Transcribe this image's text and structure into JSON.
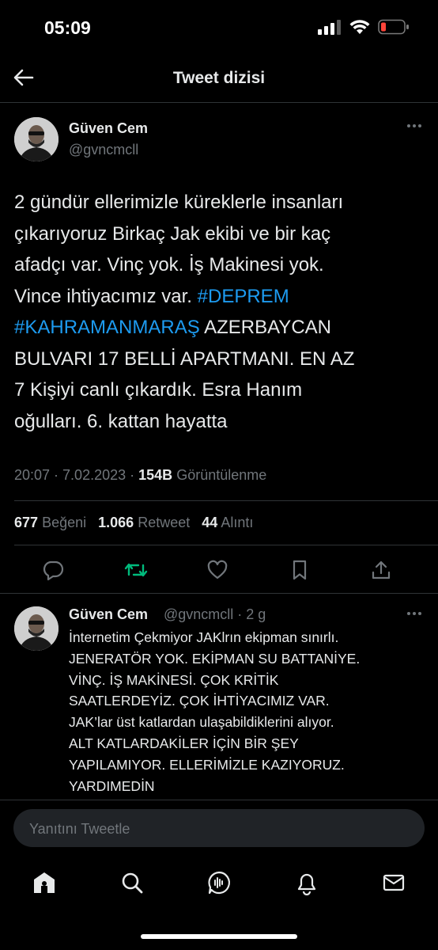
{
  "status_bar": {
    "time": "05:09"
  },
  "header": {
    "title": "Tweet dizisi"
  },
  "main_tweet": {
    "author_name": "Güven Cem",
    "author_handle": "@gvncmcll",
    "text_lines": [
      "2 gündür ellerimizle küreklerle insanları",
      "çıkarıyoruz Birkaç Jak ekibi ve bir kaç",
      "afadçı var. Vinç yok. İş Makinesi yok.",
      "Vince ihtiyacımız var."
    ],
    "hashtag_1": "#DEPREM",
    "hashtag_2": "#KAHRAMANMARAŞ",
    "text_after_lines": [
      " AZERBAYCAN",
      "BULVARI 17 BELLİ APARTMANI. EN AZ",
      "7 Kişiyi canlı çıkardık. Esra Hanım",
      "oğulları. 6. kattan hayatta"
    ],
    "timestamp": "20:07 · 7.02.2023 ·",
    "views_count": "154B",
    "views_label": "Görüntülenme",
    "likes_count": "677",
    "likes_label": "Beğeni",
    "retweets_count": "1.066",
    "retweets_label": "Retweet",
    "quotes_count": "44",
    "quotes_label": "Alıntı"
  },
  "reply_tweet": {
    "author_name": "Güven Cem",
    "author_handle": "@gvncmcll · 2 g",
    "text": "İnternetim Çekmiyor JAKlrın ekipman sınırlı.\nJENERATÖR YOK. EKİPMAN SU BATTANİYE.\nVİNÇ. İŞ MAKİNESİ. ÇOK KRİTİK\nSAATLERDEYİZ. ÇOK İHTİYACIMIZ VAR.\nJAK’lar üst katlardan ulaşabildiklerini alıyor.\nALT KATLARDAKİLER İÇİN BİR ŞEY\nYAPILAMIYOR. ELLERİMİZLE KAZIYORUZ.\nYARDIMEDİN"
  },
  "compose": {
    "placeholder": "Yanıtını Tweetle"
  },
  "colors": {
    "accent": "#1d9bf0",
    "retweet_green": "#00ba7c",
    "secondary": "#71767b",
    "battery_red": "#ff453a"
  },
  "icons": [
    "back-arrow-icon",
    "more-icon",
    "reply-icon",
    "retweet-icon",
    "like-icon",
    "bookmark-icon",
    "share-icon",
    "home-icon",
    "search-icon",
    "spaces-icon",
    "notifications-icon",
    "messages-icon"
  ]
}
